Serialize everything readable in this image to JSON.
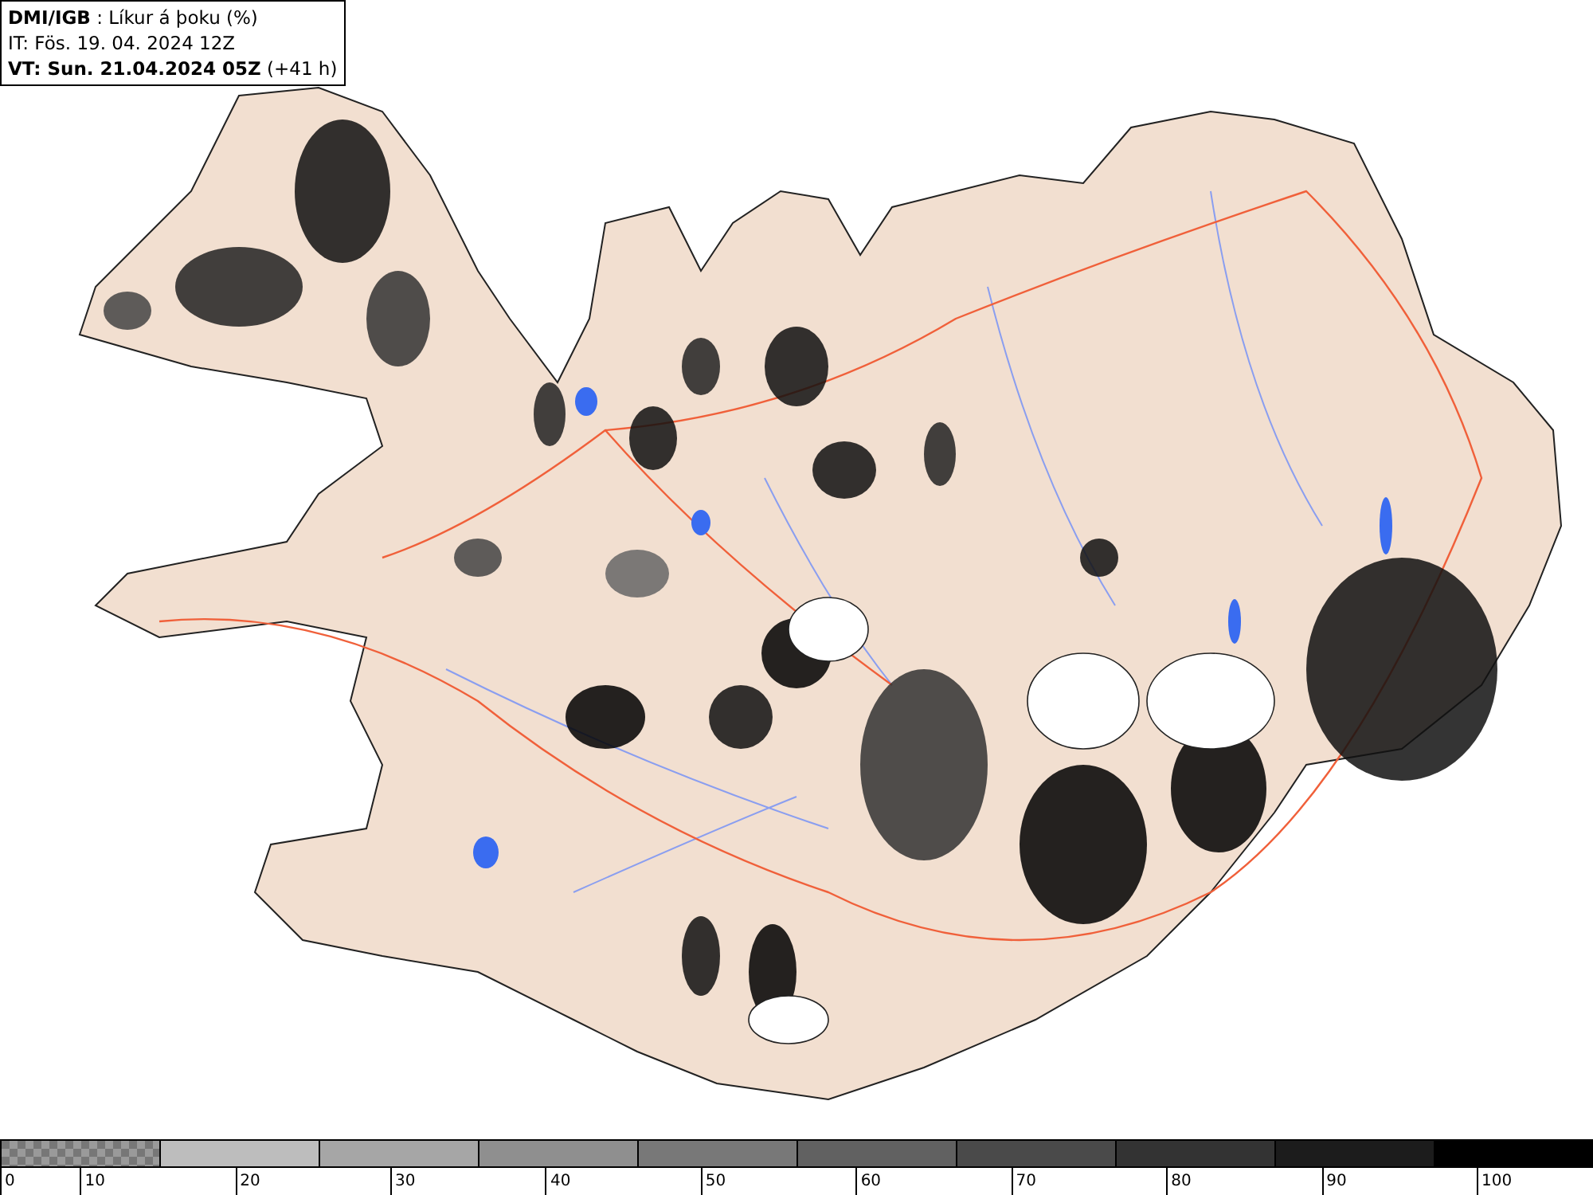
{
  "info_box": {
    "lines": [
      "**DMI/IGB** : Líkur á þoku (%)",
      "IT: Fös. 19. 04. 2024 12Z",
      "**VT: Sun. 21.04.2024 05Z** (+41 h)"
    ]
  },
  "legend": {
    "bins": [
      {
        "kind": "checker"
      },
      {
        "kind": "solid",
        "color": "#bdbdbd"
      },
      {
        "kind": "solid",
        "color": "#a6a6a6"
      },
      {
        "kind": "solid",
        "color": "#8f8f8f"
      },
      {
        "kind": "solid",
        "color": "#787878"
      },
      {
        "kind": "solid",
        "color": "#616161"
      },
      {
        "kind": "solid",
        "color": "#4a4a4a"
      },
      {
        "kind": "solid",
        "color": "#333333"
      },
      {
        "kind": "solid",
        "color": "#1c1c1c"
      },
      {
        "kind": "solid",
        "color": "#000000"
      }
    ],
    "ticks": [
      "0",
      "10",
      "20",
      "30",
      "40",
      "50",
      "60",
      "70",
      "80",
      "90",
      "100"
    ]
  }
}
